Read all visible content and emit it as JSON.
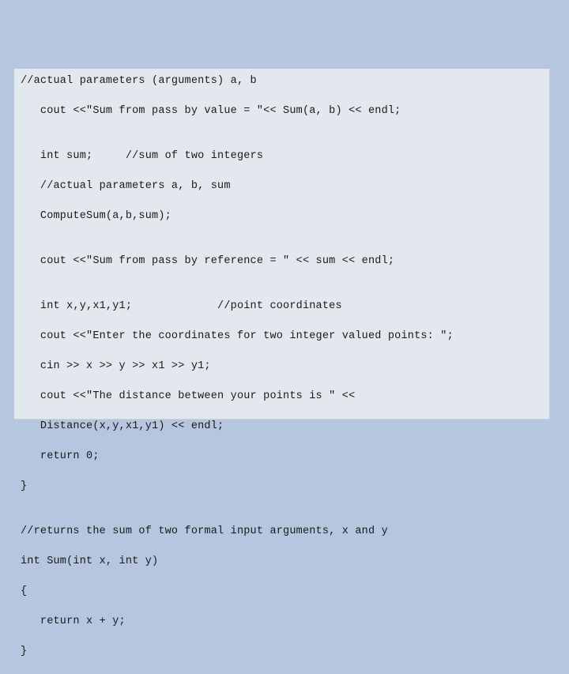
{
  "code": {
    "lines": [
      "//actual parameters (arguments) a, b",
      "   cout <<\"Sum from pass by value = \"<< Sum(a, b) << endl;",
      "",
      "   int sum;     //sum of two integers",
      "   //actual parameters a, b, sum",
      "   ComputeSum(a,b,sum);",
      "",
      "   cout <<\"Sum from pass by reference = \" << sum << endl;",
      "",
      "   int x,y,x1,y1;             //point coordinates",
      "   cout <<\"Enter the coordinates for two integer valued points: \";",
      "   cin >> x >> y >> x1 >> y1;",
      "   cout <<\"The distance between your points is \" <<",
      "   Distance(x,y,x1,y1) << endl;",
      "   return 0;",
      "}",
      "",
      "//returns the sum of two formal input arguments, x and y",
      "int Sum(int x, int y)",
      "{",
      "   return x + y;",
      "}"
    ]
  }
}
